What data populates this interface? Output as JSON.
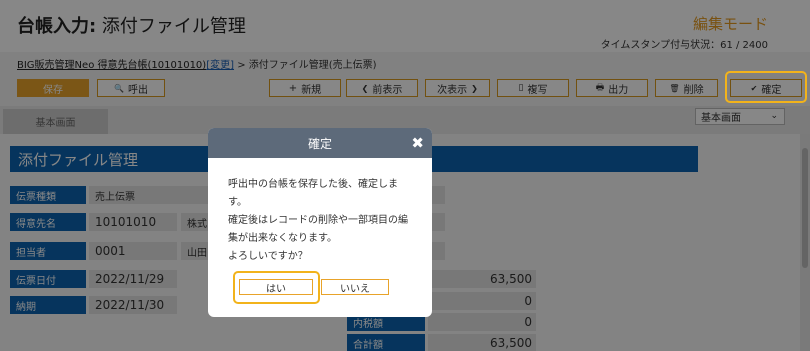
{
  "header": {
    "title_bold": "台帳入力:",
    "title_rest": " 添付ファイル管理",
    "mode": "編集モード",
    "stamp": "タイムスタンプ付与状況：61 / 2400"
  },
  "breadcrumb": {
    "link": "BIG販売管理Neo 得意先台帳(10101010)",
    "change": "[変更]",
    "rest": " > 添付ファイル管理(売上伝票)"
  },
  "toolbar": {
    "save": "保存",
    "call": "呼出",
    "new": "新規",
    "prev": "前表示",
    "next": "次表示",
    "copy": "複写",
    "output": "出力",
    "delete": "削除",
    "confirm": "確定"
  },
  "tabs": {
    "basic": "基本画面"
  },
  "view_select": {
    "value": "基本画面"
  },
  "section": {
    "title": "添付ファイル管理"
  },
  "fields": [
    {
      "label": "伝票種類",
      "value": "売上伝票"
    },
    {
      "label": "得意先名",
      "value": "10101010",
      "value2": "株式"
    },
    {
      "label": "担当者",
      "value": "0001",
      "value2": "山田"
    },
    {
      "label": "伝票日付",
      "value": "2022/11/29"
    },
    {
      "label": "納期",
      "value": "2022/11/30"
    }
  ],
  "totals": [
    {
      "label": "",
      "value": "63,500"
    },
    {
      "label": "",
      "value": "0"
    },
    {
      "label": "内税額",
      "value": "0"
    },
    {
      "label": "合計額",
      "value": "63,500"
    }
  ],
  "dialog": {
    "title": "確定",
    "close": "✖",
    "line1": "呼出中の台帳を保存した後、確定しま",
    "line2": "す。",
    "line3": "確定後はレコードの削除や一部項目の編",
    "line4": "集が出来なくなります。",
    "line5": "よろしいですか？",
    "yes": "はい",
    "no": "いいえ"
  },
  "icons": {
    "plus": "+",
    "prev": "❮",
    "next": "❯",
    "search": "🔍",
    "copy": "▯",
    "print": "🖶",
    "trash": "🗑",
    "check": "✔",
    "chevron": "⌄"
  },
  "colors": {
    "accent": "#e8a32a",
    "header_blue": "#0d63b0",
    "highlight": "#f2b31b"
  }
}
